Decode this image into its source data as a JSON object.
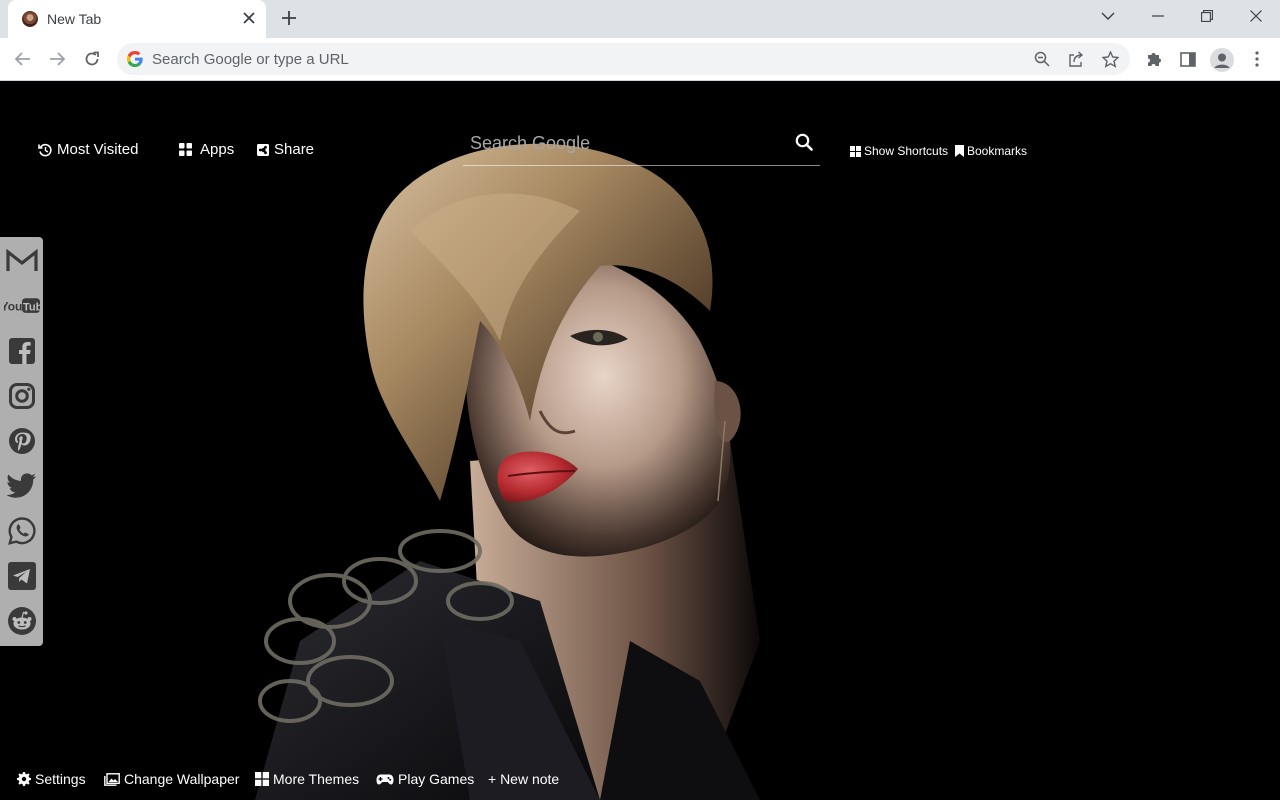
{
  "browser": {
    "tab": {
      "title": "New Tab"
    },
    "omnibox": {
      "placeholder": "Search Google or type a URL"
    }
  },
  "page": {
    "top_links": {
      "most_visited": "Most Visited",
      "apps": "Apps",
      "share": "Share",
      "show_shortcuts": "Show Shortcuts",
      "bookmarks": "Bookmarks"
    },
    "search": {
      "placeholder": "Search Google"
    },
    "social": [
      "gmail-icon",
      "youtube-icon",
      "facebook-icon",
      "instagram-icon",
      "pinterest-icon",
      "twitter-icon",
      "whatsapp-icon",
      "telegram-icon",
      "reddit-icon"
    ],
    "bottom_links": {
      "settings": "Settings",
      "change_wallpaper": "Change Wallpaper",
      "more_themes": "More Themes",
      "play_games": "Play Games",
      "new_note": "+ New note"
    }
  },
  "colors": {
    "tabstrip": "#dee1e6",
    "omnibox": "#f1f3f4",
    "page_bg": "#000000",
    "lips": "#b42a2e"
  }
}
